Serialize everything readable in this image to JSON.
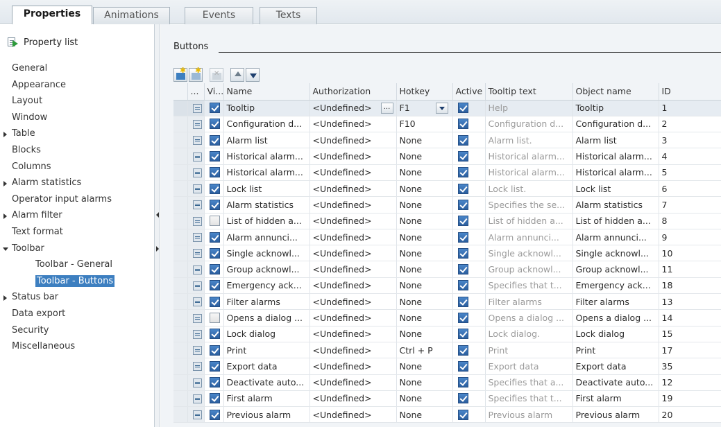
{
  "tabs": [
    {
      "label": "Properties",
      "active": true
    },
    {
      "label": "Animations",
      "active": false
    },
    {
      "label": "Events",
      "active": false
    },
    {
      "label": "Texts",
      "active": false
    }
  ],
  "sidebar": {
    "header": "Property list",
    "items": [
      {
        "label": "General",
        "type": "leaf"
      },
      {
        "label": "Appearance",
        "type": "leaf"
      },
      {
        "label": "Layout",
        "type": "leaf"
      },
      {
        "label": "Window",
        "type": "leaf"
      },
      {
        "label": "Table",
        "type": "collapsed"
      },
      {
        "label": "Blocks",
        "type": "leaf"
      },
      {
        "label": "Columns",
        "type": "leaf"
      },
      {
        "label": "Alarm statistics",
        "type": "collapsed"
      },
      {
        "label": "Operator input alarms",
        "type": "leaf"
      },
      {
        "label": "Alarm filter",
        "type": "collapsed"
      },
      {
        "label": "Text format",
        "type": "leaf"
      },
      {
        "label": "Toolbar",
        "type": "expanded"
      },
      {
        "label": "Toolbar - General",
        "type": "child"
      },
      {
        "label": "Toolbar - Buttons",
        "type": "child",
        "selected": true
      },
      {
        "label": "Status bar",
        "type": "collapsed"
      },
      {
        "label": "Data export",
        "type": "leaf"
      },
      {
        "label": "Security",
        "type": "leaf"
      },
      {
        "label": "Miscellaneous",
        "type": "leaf"
      }
    ]
  },
  "section": {
    "title": "Buttons"
  },
  "toolbar_icons": [
    "add-new-icon",
    "insert-icon",
    "delete-icon",
    "move-up-icon",
    "move-down-icon"
  ],
  "table": {
    "columns": [
      "...",
      "Vi...",
      "Name",
      "Authorization",
      "Hotkey",
      "Active",
      "Tooltip text",
      "Object name",
      "ID"
    ],
    "rows": [
      {
        "visible": true,
        "name": "Tooltip",
        "authorization": "<Undefined>",
        "hotkey": "F1",
        "active": true,
        "tooltip": "Help",
        "object_name": "Tooltip",
        "id": "1",
        "selected": true
      },
      {
        "visible": true,
        "name": "Configuration d...",
        "authorization": "<Undefined>",
        "hotkey": "F10",
        "active": true,
        "tooltip": "Configuration d...",
        "object_name": "Configuration d...",
        "id": "2"
      },
      {
        "visible": true,
        "name": "Alarm list",
        "authorization": "<Undefined>",
        "hotkey": "None",
        "active": true,
        "tooltip": "Alarm list.",
        "object_name": "Alarm list",
        "id": "3"
      },
      {
        "visible": true,
        "name": "Historical alarm...",
        "authorization": "<Undefined>",
        "hotkey": "None",
        "active": true,
        "tooltip": "Historical alarm...",
        "object_name": "Historical alarm...",
        "id": "4"
      },
      {
        "visible": true,
        "name": "Historical alarm...",
        "authorization": "<Undefined>",
        "hotkey": "None",
        "active": true,
        "tooltip": "Historical alarm...",
        "object_name": "Historical alarm...",
        "id": "5"
      },
      {
        "visible": true,
        "name": "Lock list",
        "authorization": "<Undefined>",
        "hotkey": "None",
        "active": true,
        "tooltip": "Lock list.",
        "object_name": "Lock list",
        "id": "6"
      },
      {
        "visible": true,
        "name": "Alarm statistics",
        "authorization": "<Undefined>",
        "hotkey": "None",
        "active": true,
        "tooltip": "Specifies the se...",
        "object_name": "Alarm statistics",
        "id": "7"
      },
      {
        "visible": false,
        "name": "List of hidden a...",
        "authorization": "<Undefined>",
        "hotkey": "None",
        "active": true,
        "tooltip": "List of hidden a...",
        "object_name": "List of hidden a...",
        "id": "8"
      },
      {
        "visible": true,
        "name": "Alarm annunci...",
        "authorization": "<Undefined>",
        "hotkey": "None",
        "active": true,
        "tooltip": "Alarm annunci...",
        "object_name": "Alarm annunci...",
        "id": "9"
      },
      {
        "visible": true,
        "name": "Single acknowl...",
        "authorization": "<Undefined>",
        "hotkey": "None",
        "active": true,
        "tooltip": "Single acknowl...",
        "object_name": "Single acknowl...",
        "id": "10"
      },
      {
        "visible": true,
        "name": "Group acknowl...",
        "authorization": "<Undefined>",
        "hotkey": "None",
        "active": true,
        "tooltip": "Group acknowl...",
        "object_name": "Group acknowl...",
        "id": "11"
      },
      {
        "visible": true,
        "name": "Emergency ack...",
        "authorization": "<Undefined>",
        "hotkey": "None",
        "active": true,
        "tooltip": "Specifies that t...",
        "object_name": "Emergency ack...",
        "id": "18"
      },
      {
        "visible": true,
        "name": "Filter alarms",
        "authorization": "<Undefined>",
        "hotkey": "None",
        "active": true,
        "tooltip": "Filter alarms",
        "object_name": "Filter alarms",
        "id": "13"
      },
      {
        "visible": false,
        "name": "Opens a dialog ...",
        "authorization": "<Undefined>",
        "hotkey": "None",
        "active": true,
        "tooltip": "Opens a dialog ...",
        "object_name": "Opens a dialog ...",
        "id": "14"
      },
      {
        "visible": true,
        "name": "Lock dialog",
        "authorization": "<Undefined>",
        "hotkey": "None",
        "active": true,
        "tooltip": "Lock dialog.",
        "object_name": "Lock dialog",
        "id": "15"
      },
      {
        "visible": true,
        "name": "Print",
        "authorization": "<Undefined>",
        "hotkey": "Ctrl + P",
        "active": true,
        "tooltip": "Print",
        "object_name": "Print",
        "id": "17"
      },
      {
        "visible": true,
        "name": "Export data",
        "authorization": "<Undefined>",
        "hotkey": "None",
        "active": true,
        "tooltip": "Export data",
        "object_name": "Export data",
        "id": "35"
      },
      {
        "visible": true,
        "name": "Deactivate auto...",
        "authorization": "<Undefined>",
        "hotkey": "None",
        "active": true,
        "tooltip": "Specifies that a...",
        "object_name": "Deactivate auto...",
        "id": "12"
      },
      {
        "visible": true,
        "name": "First alarm",
        "authorization": "<Undefined>",
        "hotkey": "None",
        "active": true,
        "tooltip": "Specifies that t...",
        "object_name": "First alarm",
        "id": "19"
      },
      {
        "visible": true,
        "name": "Previous alarm",
        "authorization": "<Undefined>",
        "hotkey": "None",
        "active": true,
        "tooltip": "Previous alarm",
        "object_name": "Previous alarm",
        "id": "20"
      }
    ]
  },
  "colors": {
    "accent": "#3d7fc0",
    "muted_text": "#9a9a9a"
  }
}
